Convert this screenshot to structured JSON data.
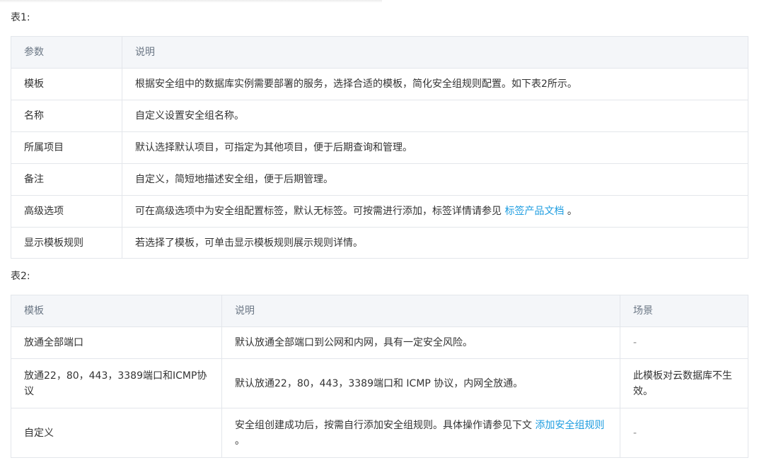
{
  "table1": {
    "caption": "表1:",
    "headers": [
      "参数",
      "说明"
    ],
    "rows": [
      {
        "param": "模板",
        "desc": "根据安全组中的数据库实例需要部署的服务，选择合适的模板，简化安全组规则配置。如下表2所示。"
      },
      {
        "param": "名称",
        "desc": "自定义设置安全组名称。"
      },
      {
        "param": "所属项目",
        "desc": "默认选择默认项目，可指定为其他项目，便于后期查询和管理。"
      },
      {
        "param": "备注",
        "desc": "自定义，简短地描述安全组，便于后期管理。"
      },
      {
        "param": "高级选项",
        "desc_before": "可在高级选项中为安全组配置标签，默认无标签。可按需进行添加，标签详情请参见 ",
        "link": "标签产品文档",
        "desc_after": " 。"
      },
      {
        "param": "显示模板规则",
        "desc": "若选择了模板，可单击显示模板规则展示规则详情。"
      }
    ]
  },
  "table2": {
    "caption": "表2:",
    "headers": [
      "模板",
      "说明",
      "场景"
    ],
    "rows": [
      {
        "template": "放通全部端口",
        "desc": "默认放通全部端口到公网和内网，具有一定安全风险。",
        "scene": "-"
      },
      {
        "template": "放通22，80，443，3389端口和ICMP协议",
        "desc": "默认放通22，80，443，3389端口和 ICMP 协议，内网全放通。",
        "scene": "此模板对云数据库不生效。"
      },
      {
        "template": "自定义",
        "desc_before": "安全组创建成功后，按需自行添加安全组规则。具体操作请参见下文 ",
        "link": "添加安全组规则",
        "desc_after": " 。",
        "scene": "-"
      }
    ]
  }
}
